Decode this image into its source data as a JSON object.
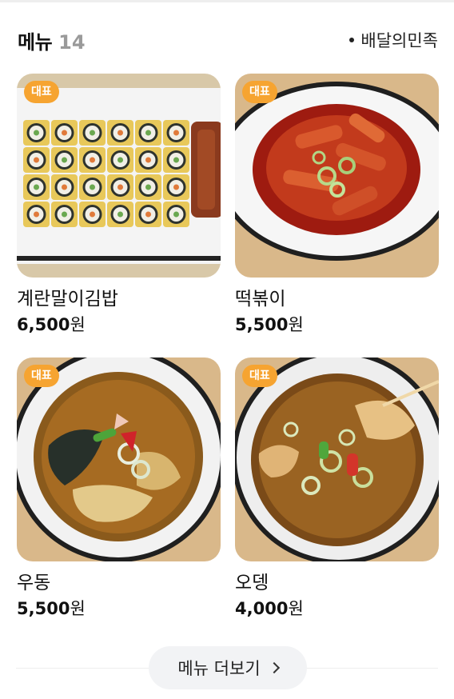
{
  "header": {
    "title": "메뉴",
    "count": "14",
    "provider": "배달의민족"
  },
  "badge_label": "대표",
  "menu": [
    {
      "name": "계란말이김밥",
      "price": "6,500",
      "currency": "원"
    },
    {
      "name": "떡볶이",
      "price": "5,500",
      "currency": "원"
    },
    {
      "name": "우동",
      "price": "5,500",
      "currency": "원"
    },
    {
      "name": "오뎅",
      "price": "4,000",
      "currency": "원"
    }
  ],
  "more_button": {
    "label": "메뉴 더보기"
  },
  "colors": {
    "badge": "#f6a431",
    "count": "#9a9a9a",
    "button_bg": "#f2f3f5"
  }
}
